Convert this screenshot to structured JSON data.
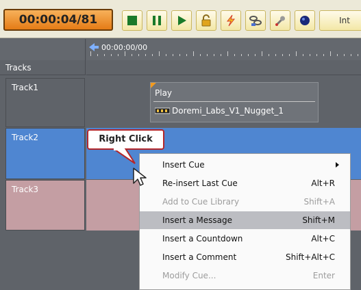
{
  "toolbar": {
    "timecode": "00:00:04/81",
    "buttons": [
      {
        "icon": "stop-icon"
      },
      {
        "icon": "pause-icon"
      },
      {
        "icon": "play-icon"
      },
      {
        "icon": "lock-icon"
      },
      {
        "icon": "flash-icon"
      },
      {
        "icon": "chain-icon"
      },
      {
        "icon": "wrench-icon"
      },
      {
        "icon": "record-icon"
      }
    ],
    "truncated_label": "Int"
  },
  "ruler": {
    "start_time": "00:00:00/00"
  },
  "tracks_header": "Tracks",
  "tracks": [
    {
      "label": "Track1",
      "color": "#5f6369"
    },
    {
      "label": "Track2",
      "color": "#4f86d1"
    },
    {
      "label": "Track3",
      "color": "#c49ea3"
    }
  ],
  "cue": {
    "title": "Play",
    "name": "Doremi_Labs_V1_Nugget_1"
  },
  "callout": {
    "text": "Right Click"
  },
  "context_menu": {
    "items": [
      {
        "label": "Insert Cue",
        "shortcut": "",
        "submenu": true,
        "disabled": false,
        "highlighted": false
      },
      {
        "label": "Re-insert Last Cue",
        "shortcut": "Alt+R",
        "submenu": false,
        "disabled": false,
        "highlighted": false
      },
      {
        "label": "Add to Cue Library",
        "shortcut": "Shift+A",
        "submenu": false,
        "disabled": true,
        "highlighted": false
      },
      {
        "label": "Insert a Message",
        "shortcut": "Shift+M",
        "submenu": false,
        "disabled": false,
        "highlighted": true
      },
      {
        "label": "Insert a Countdown",
        "shortcut": "Alt+C",
        "submenu": false,
        "disabled": false,
        "highlighted": false
      },
      {
        "label": "Insert a Comment",
        "shortcut": "Shift+Alt+C",
        "submenu": false,
        "disabled": false,
        "highlighted": false
      },
      {
        "label": "Modify Cue...",
        "shortcut": "Enter",
        "submenu": false,
        "disabled": true,
        "highlighted": false
      }
    ]
  },
  "colors": {
    "timecode_bg": "#e57c16",
    "highlight": "#bcbdc2",
    "callout_border": "#b3262a"
  }
}
